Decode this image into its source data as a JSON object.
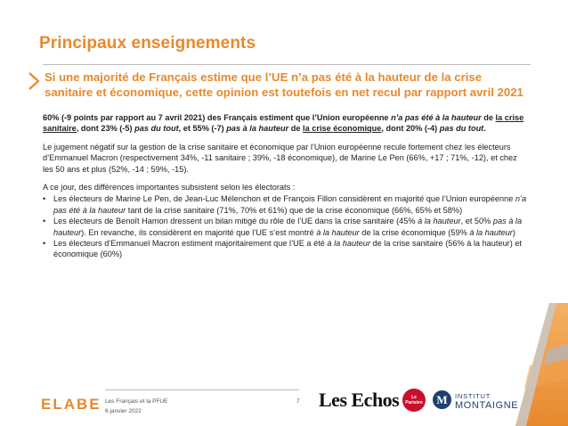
{
  "title": "Principaux enseignements",
  "headline": "Si une majorité de Français estime que l’UE n’a pas été à la hauteur de la crise sanitaire et économique, cette opinion est toutefois en net recul par rapport avril 2021",
  "p1": {
    "a": "60% (-9 points par rapport au 7 avril 2021) des Français estiment que l’Union européenne ",
    "b": "n’a pas été à la hauteur",
    "c": " de ",
    "d": "la crise sanitaire",
    "e": ", dont 23% (-5) ",
    "f": "pas du tout",
    "g": ", et 55% (-7) ",
    "h": "pas à la hauteur",
    "i": " de ",
    "j": "la crise économique",
    "k": ", dont 20% (-4) ",
    "l": "pas du tout",
    "m": "."
  },
  "p2": "Le jugement négatif sur la gestion de la crise sanitaire et économique par l’Union européenne recule fortement chez les électeurs d’Emmanuel Macron (respectivement 34%, -11 sanitaire ; 39%, -18 économique), de Marine Le Pen (66%, +17 ; 71%, -12), et chez les 50 ans et plus (52%, -14 ; 59%, -15).",
  "p3": "A ce jour, des différences importantes subsistent selon les électorats :",
  "bullet1": {
    "a": "Les électeurs de Marine Le Pen, de Jean-Luc Mélenchon et de François Fillon considèrent en majorité que l’Union européenne ",
    "b": "n’a pas été à la hauteur",
    "c": " tant de la crise sanitaire (71%, 70% et 61%) que de la crise économique (66%, 65% et 58%)"
  },
  "bullet2": {
    "a": "Les électeurs de Benoît Hamon dressent un bilan mitigé du rôle de l’UE dans la crise sanitaire (45% ",
    "b": "à la hauteur",
    "c": ", et 50% ",
    "d": "pas à la hauteur",
    "e": "). En revanche, ils considèrent en majorité que l’UE s’est montré ",
    "f": "à la hauteur",
    "g": " de la crise économique (59% ",
    "h": "à la hauteur",
    "i": ")"
  },
  "bullet3": {
    "a": "Les électeurs d’Emmanuel Macron estiment majoritairement que l’UE a été ",
    "b": "à la hauteur",
    "c": " de la crise sanitaire (56% à la hauteur) et économique (60%)"
  },
  "footer": {
    "elabe": "ELABE",
    "line1": "Les Français et la PFUE",
    "line2": "6 janvier 2022",
    "page": "7",
    "lesechos": "Les Echos",
    "red_logo": "Le Parisien",
    "m_logo": "M",
    "institut": "INSTITUT",
    "montaigne": "MONTAIGNE"
  },
  "colors": {
    "accent": "#e8892c",
    "navy": "#1f3f6e",
    "red": "#c8102e"
  }
}
